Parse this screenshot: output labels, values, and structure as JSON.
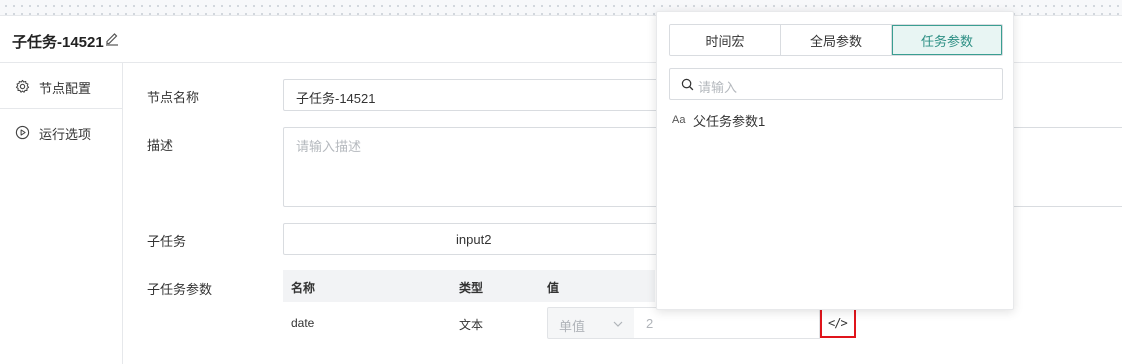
{
  "header": {
    "title": "子任务-14521"
  },
  "sidebar": {
    "items": [
      {
        "label": "节点配置",
        "icon": "gear-icon"
      },
      {
        "label": "运行选项",
        "icon": "play-circle-icon"
      }
    ]
  },
  "form": {
    "node_name_label": "节点名称",
    "node_name_value": "子任务-14521",
    "description_label": "描述",
    "description_placeholder": "请输入描述",
    "subtask_label": "子任务",
    "subtask_value": "input2",
    "subtask_params_label": "子任务参数"
  },
  "params_table": {
    "columns": [
      "名称",
      "类型",
      "值"
    ],
    "rows": [
      {
        "name": "date",
        "type": "文本",
        "mode": "单值",
        "value": "2"
      }
    ],
    "code_button_label": "</>"
  },
  "popover": {
    "tabs": [
      {
        "label": "时间宏",
        "active": false
      },
      {
        "label": "全局参数",
        "active": false
      },
      {
        "label": "任务参数",
        "active": true
      }
    ],
    "search_placeholder": "请输入",
    "items": [
      {
        "type_badge": "Aa",
        "label": "父任务参数1"
      }
    ]
  },
  "colors": {
    "accent": "#2d8f84",
    "highlight_border": "#e0141b"
  }
}
